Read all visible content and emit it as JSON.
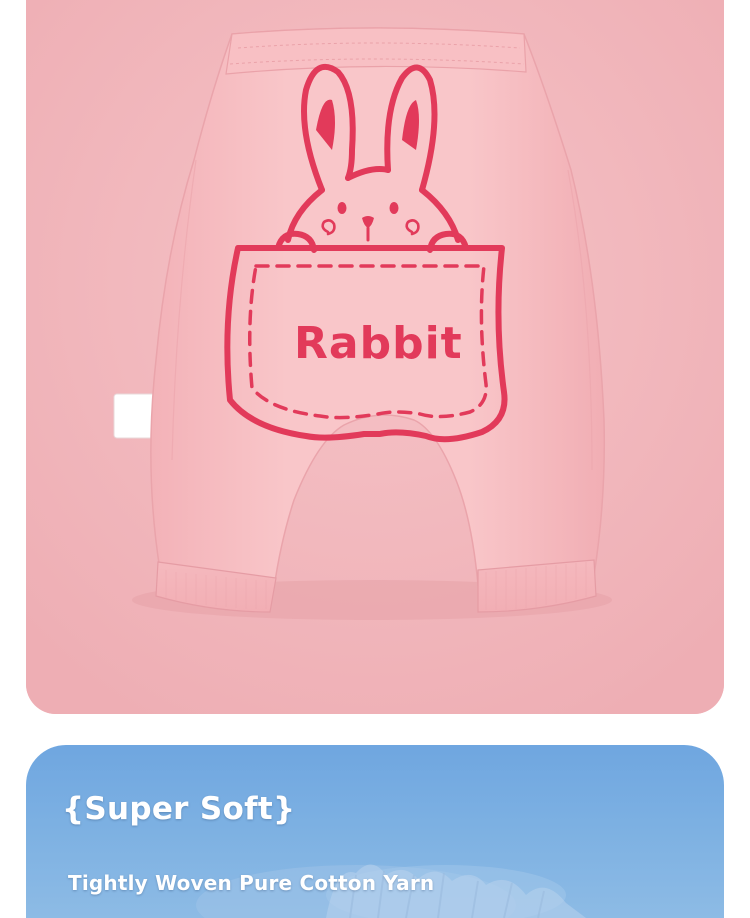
{
  "hero": {
    "print_text": "Rabbit",
    "colors": {
      "background": "#f2b8bd",
      "fabric": "#f8c3c6",
      "print": "#e23a5a"
    }
  },
  "feature": {
    "heading": "{Super Soft}",
    "subheading": "Tightly Woven Pure Cotton Yarn",
    "colors": {
      "background": "#7cb0e2",
      "text": "#ffffff"
    }
  }
}
